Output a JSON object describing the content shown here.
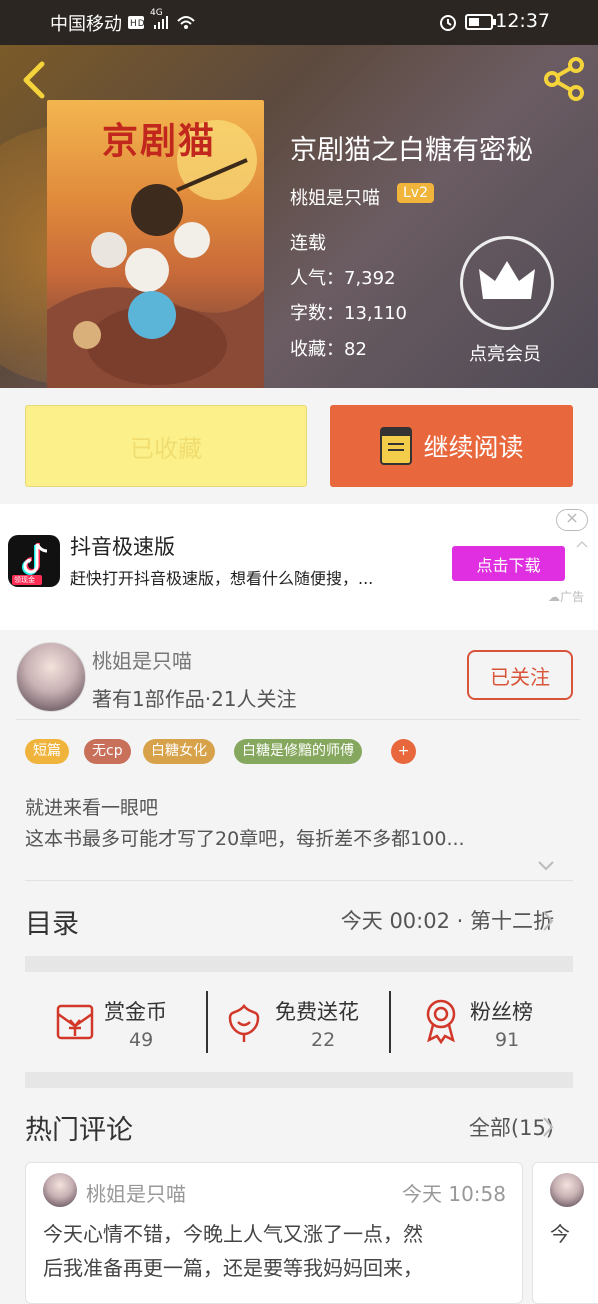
{
  "status_bar": {
    "carrier": "中国移动",
    "network": "4G",
    "time": "12:37"
  },
  "book": {
    "title": "京剧猫之白糖有密秘",
    "author": "桃姐是只喵",
    "level": "Lv2",
    "status": "连载",
    "popularity_label": "人气：",
    "popularity": "7,392",
    "word_count_label": "字数：",
    "word_count": "13,110",
    "favorites_label": "收藏：",
    "favorites": "82",
    "vip_label": "点亮会员",
    "cover_text": "京剧猫"
  },
  "actions": {
    "collected_label": "已收藏",
    "continue_label": "继续阅读"
  },
  "ad": {
    "app_name": "抖音极速版",
    "description": "赶快打开抖音极速版，想看什么随便搜，...",
    "download_label": "点击下载",
    "ad_label": "广告",
    "icon_badge": "领现金"
  },
  "author_card": {
    "name": "桃姐是只喵",
    "stats": "著有1部作品·21人关注",
    "follow_label": "已关注"
  },
  "tags": [
    {
      "label": "短篇",
      "color": "#f0b43c"
    },
    {
      "label": "无cp",
      "color": "#c8705a"
    },
    {
      "label": "白糖女化",
      "color": "#d7a24a"
    },
    {
      "label": "白糖是修黯的师傅",
      "color": "#86a85e"
    },
    {
      "label": "+",
      "color": "#e9673c"
    }
  ],
  "intro": {
    "line1": "就进来看一眼吧",
    "line2": "这本书最多可能才写了20章吧，每折差不多都100..."
  },
  "toc": {
    "title": "目录",
    "latest": "今天 00:02 · 第十二折"
  },
  "stats": [
    {
      "label": "赏金币",
      "value": "49",
      "icon": "coin-envelope-icon"
    },
    {
      "label": "免费送花",
      "value": "22",
      "icon": "flower-icon"
    },
    {
      "label": "粉丝榜",
      "value": "91",
      "icon": "medal-icon"
    }
  ],
  "hot_comments": {
    "title": "热门评论",
    "all_label": "全部(15)",
    "comment": {
      "user": "桃姐是只喵",
      "time": "今天 10:58",
      "line1": "今天心情不错，今晚上人气又涨了一点，然",
      "line2": "后我准备再更一篇，还是要等我妈妈回来，",
      "next_preview": "今"
    }
  },
  "colors": {
    "accent": "#e9673c",
    "collected_bg": "#fbf08a",
    "ad_button": "#e02fe0"
  }
}
